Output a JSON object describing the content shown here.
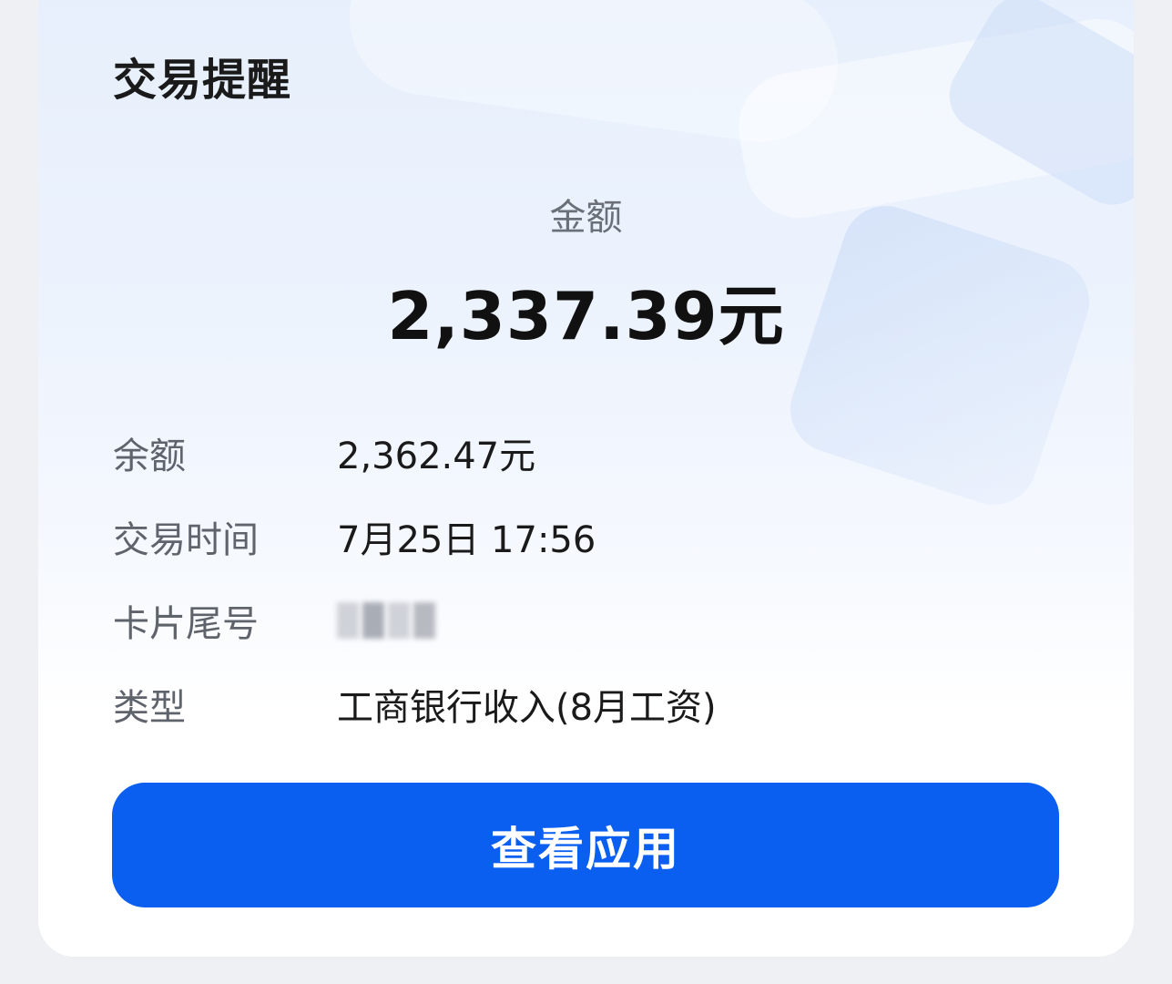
{
  "card": {
    "title": "交易提醒",
    "amount_label": "金额",
    "amount_value": "2,337.39元",
    "details": [
      {
        "label": "余额",
        "value": "2,362.47元"
      },
      {
        "label": "交易时间",
        "value": "7月25日 17:56"
      },
      {
        "label": "卡片尾号",
        "value": ""
      },
      {
        "label": "类型",
        "value": "工商银行收入(8月工资)"
      }
    ],
    "button_label": "查看应用"
  },
  "colors": {
    "accent": "#0a5ef0",
    "title": "#1a1a1a",
    "label": "#5f636b"
  }
}
